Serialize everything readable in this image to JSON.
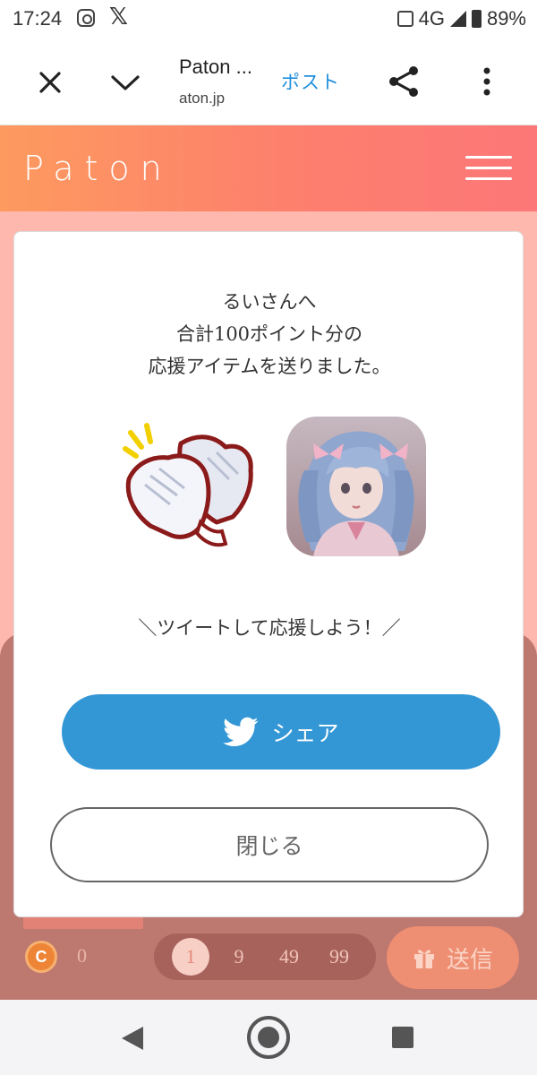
{
  "status_bar": {
    "time": "17:24",
    "network": "4G",
    "battery": "89%",
    "icons": [
      "instagram-icon",
      "x-icon",
      "vibrate-icon",
      "signal-icon",
      "battery-icon"
    ]
  },
  "browser_bar": {
    "title": "Paton ...",
    "url": "aton.jp",
    "post_label": "ポスト",
    "icons": [
      "close-icon",
      "chevron-down-icon",
      "share-icon",
      "more-vertical-icon"
    ]
  },
  "site_header": {
    "logo": "Paton",
    "menu_icon": "hamburger-icon"
  },
  "modal": {
    "message_line1": "るいさんへ",
    "message_line2": "合計100ポイント分の",
    "message_line3": "応援アイテムを送りました。",
    "item_icon": "clapping-hands-icon",
    "avatar_icon": "user-avatar",
    "cheer_text": "＼ツイートして応援しよう！／",
    "share_label": "シェア",
    "share_icon": "twitter-bird-icon",
    "close_label": "閉じる"
  },
  "bottom_bar": {
    "coin_label": "C",
    "coin_count": "0",
    "points": [
      "1",
      "9",
      "49",
      "99"
    ],
    "selected_point": "1",
    "send_label": "送信",
    "send_icon": "gift-icon"
  },
  "colors": {
    "header_gradient_start": "#fd9a5f",
    "header_gradient_end": "#fc7778",
    "share_button": "#3397d6",
    "post_link": "#1f8fdd",
    "page_background": "#ffb8ad"
  }
}
